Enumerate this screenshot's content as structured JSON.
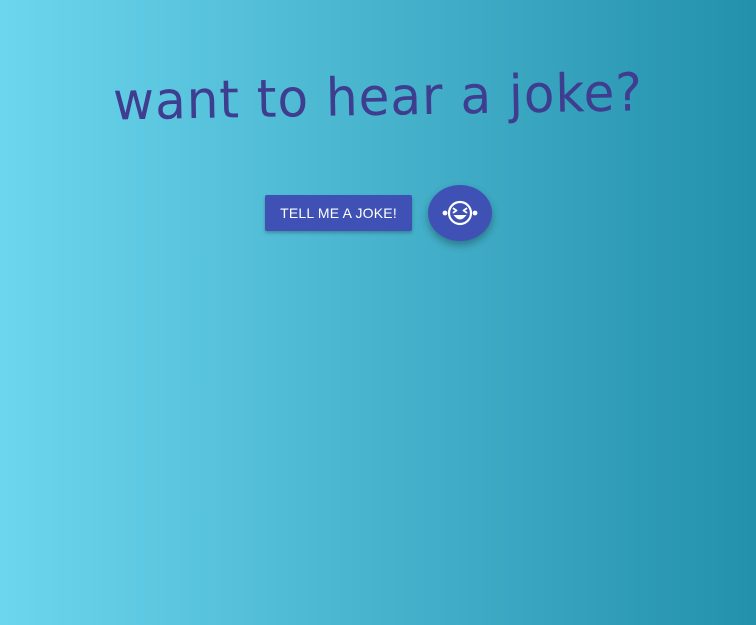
{
  "header": {
    "title": "want to hear a joke?"
  },
  "actions": {
    "joke_button_label": "TELL ME A JOKE!",
    "fab_icon": "laughing-face-icon"
  },
  "colors": {
    "gradient_start": "#6cd6ee",
    "gradient_end": "#2390ac",
    "title": "#3f3d8f",
    "primary": "#3f51b5",
    "on_primary": "#ffffff"
  }
}
